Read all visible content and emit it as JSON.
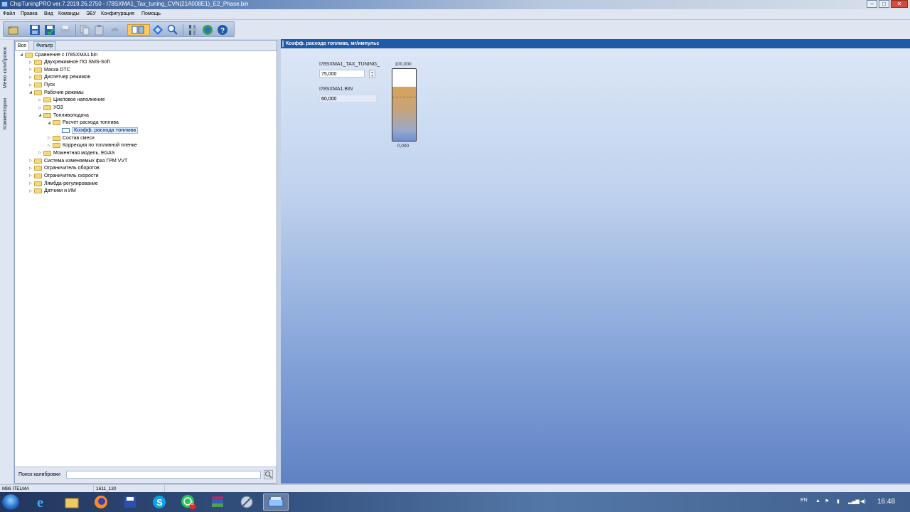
{
  "window": {
    "title": "ChipTuningPRO ver.7.2019.26.2750 - I78SXMA1_Tax_tuning_CVN(21A008E1)_E2_Phase.bin",
    "controls": [
      "–",
      "□",
      "✕"
    ]
  },
  "menu": [
    "Файл",
    "Правка",
    "Вид",
    "Команды",
    "ЭБУ",
    "Конфигурация",
    "Помощь"
  ],
  "toolbar": {
    "buttons": [
      "open-icon",
      "save-icon",
      "save-check-icon",
      "print-icon",
      "copy-icon",
      "paste-icon",
      "undo-icon",
      "compare-icon",
      "navigate-icon",
      "zoom-search-icon",
      "tools-icon",
      "update-icon",
      "help-icon"
    ]
  },
  "side_tabs": [
    "Меню калибровок",
    "Комментарии"
  ],
  "left_panel": {
    "tabs": [
      "Все",
      "Фильтр"
    ],
    "active_tab": "Фильтр",
    "tree": [
      {
        "label": "Сравнение с I78SXMA1.bin",
        "level": 0,
        "expanded": true
      },
      {
        "label": "Двухрежимное ПО SMS-Soft",
        "level": 1,
        "expanded": false
      },
      {
        "label": "Маска DTC",
        "level": 1,
        "expanded": false
      },
      {
        "label": "Диспетчер режимов",
        "level": 1,
        "expanded": false
      },
      {
        "label": "Пуск",
        "level": 1,
        "expanded": false
      },
      {
        "label": "Рабочие режимы",
        "level": 1,
        "expanded": true
      },
      {
        "label": "Цикловое наполнение",
        "level": 2,
        "expanded": false
      },
      {
        "label": "УОЗ",
        "level": 2,
        "expanded": false
      },
      {
        "label": "Топливоподача",
        "level": 2,
        "expanded": true
      },
      {
        "label": "Расчет расхода топлива",
        "level": 3,
        "expanded": true
      },
      {
        "label": "Коэфф. расхода топлива",
        "level": 4,
        "selected": true
      },
      {
        "label": "Состав смеси",
        "level": 3,
        "expanded": false
      },
      {
        "label": "Коррекция по топливной пленке",
        "level": 3,
        "expanded": false
      },
      {
        "label": "Моментная модель, EGAS",
        "level": 2,
        "expanded": false
      },
      {
        "label": "Система изменяемых фаз ГРМ VVT",
        "level": 1,
        "expanded": false
      },
      {
        "label": "Ограничитель оборотов",
        "level": 1,
        "expanded": false
      },
      {
        "label": "Ограничитель скорости",
        "level": 1,
        "expanded": false
      },
      {
        "label": "Лямбда-регулирование",
        "level": 1,
        "expanded": false
      },
      {
        "label": "Датчики и ИМ",
        "level": 1,
        "expanded": false
      }
    ],
    "search": {
      "label": "Поиск калибровки",
      "value": ""
    }
  },
  "right_panel": {
    "title": "Коэфф. расхода топлива, мг/импульс",
    "editor": {
      "current_file": "I78SXMA1_TAX_TUNING_",
      "current_value": "75,000",
      "compare_file": "I78SXMA1.BIN",
      "compare_value": "60,000"
    },
    "gauge": {
      "max_label": "100,000",
      "min_label": "0,000",
      "min": 0,
      "max": 100,
      "value": 75,
      "compare_value": 60
    }
  },
  "statusbar": [
    "M86 ITELMA",
    "1611_130"
  ],
  "taskbar": {
    "apps": [
      "ie-icon",
      "explorer-icon",
      "firefox-icon",
      "save-app-icon",
      "skype-icon",
      "whatsapp-icon",
      "winrar-icon",
      "tuning-tool-icon",
      "chiptuningpro-icon"
    ],
    "whatsapp_badge": "2",
    "lang": "EN",
    "time": "16:48"
  }
}
